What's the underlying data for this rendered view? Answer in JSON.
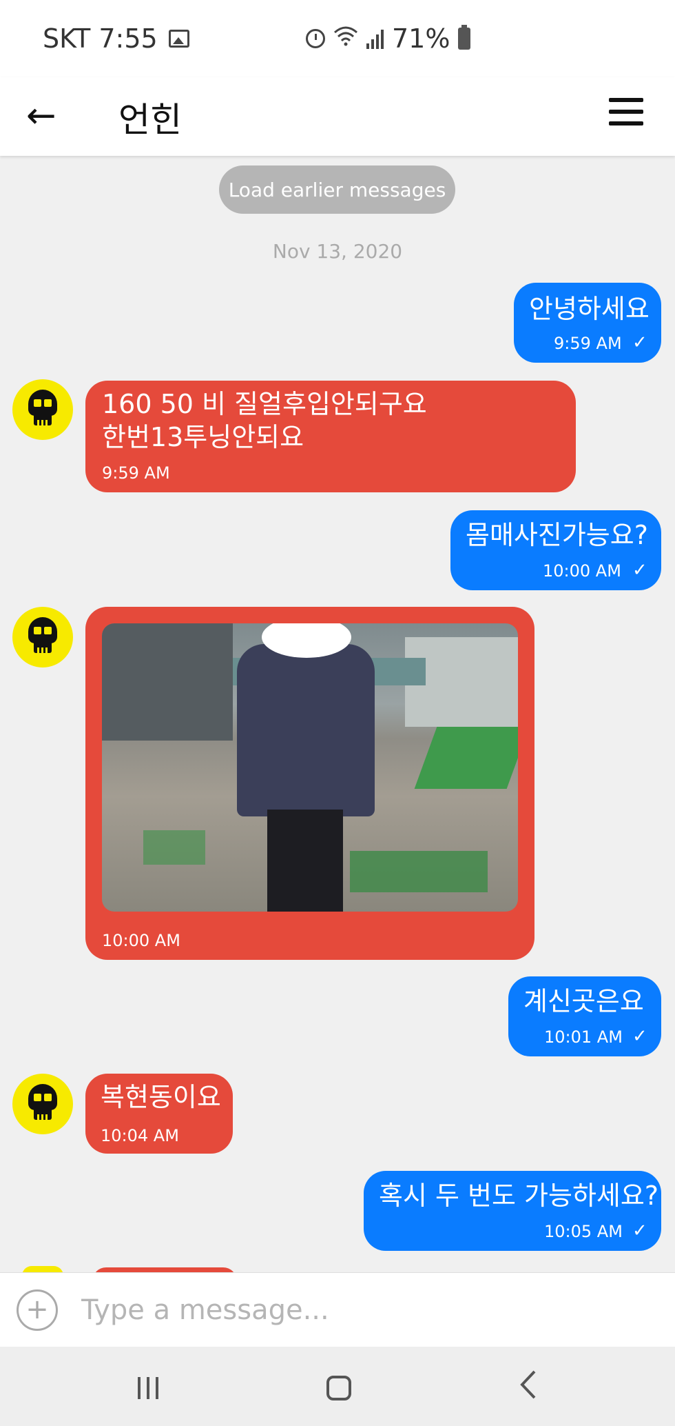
{
  "status_bar": {
    "carrier_time": "SKT 7:55",
    "battery": "71%",
    "icons": [
      "gallery-icon",
      "alarm-icon",
      "wifi-icon",
      "signal-icon",
      "battery-icon"
    ]
  },
  "header": {
    "title": "언힌",
    "back_icon": "←"
  },
  "chat": {
    "load_earlier": "Load earlier messages",
    "date": "Nov 13, 2020",
    "messages": [
      {
        "direction": "sent",
        "text": "안녕하세요",
        "time": "9:59 AM",
        "status": "✓"
      },
      {
        "direction": "received",
        "text_line1": "160 50 비 질얼후입안되구요",
        "text_line2": "한번13투닝안되요",
        "time": "9:59 AM"
      },
      {
        "direction": "sent",
        "text": "몸매사진가능요?",
        "time": "10:00 AM",
        "status": "✓"
      },
      {
        "direction": "received",
        "type": "image",
        "time": "10:00 AM"
      },
      {
        "direction": "sent",
        "text": "계신곳은요",
        "time": "10:01 AM",
        "status": "✓"
      },
      {
        "direction": "received",
        "text": "복현동이요",
        "time": "10:04 AM"
      },
      {
        "direction": "sent",
        "text": "혹시 두 번도 가능하세요?",
        "time": "10:05 AM",
        "status": "✓"
      }
    ]
  },
  "composer": {
    "placeholder": "Type a message...",
    "add_icon": "+"
  },
  "colors": {
    "sent_bubble": "#0a7cff",
    "received_bubble": "#e54a3b",
    "avatar_bg": "#f7ea00",
    "background": "#f0f0f0"
  }
}
